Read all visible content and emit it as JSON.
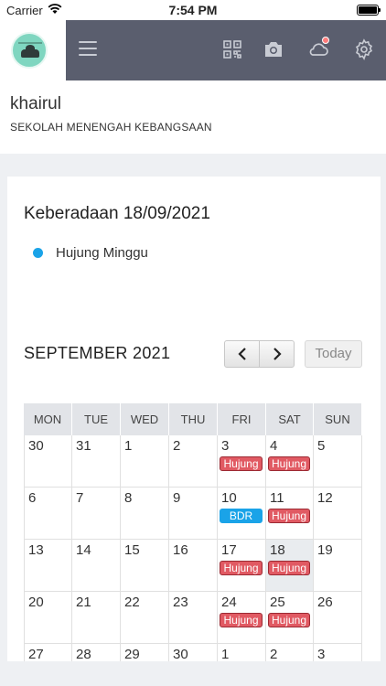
{
  "status_bar": {
    "carrier": "Carrier",
    "time": "7:54 PM"
  },
  "header": {
    "icons": [
      "menu-icon",
      "qr-code-icon",
      "camera-icon",
      "cloud-icon",
      "gear-icon"
    ],
    "colors": {
      "bar": "#5a5e6e",
      "notification": "#ff7c7c"
    }
  },
  "profile": {
    "name": "khairul",
    "school": "SEKOLAH MENENGAH KEBANGSAAN"
  },
  "attendance": {
    "title": "Keberadaan 18/09/2021",
    "legend": [
      {
        "label": "Hujung Minggu",
        "color": "#1aa3e8"
      }
    ]
  },
  "calendar": {
    "month_label": "SEPTEMBER 2021",
    "prev_label": "‹",
    "next_label": "›",
    "today_label": "Today",
    "weekdays": [
      "MON",
      "TUE",
      "WED",
      "THU",
      "FRI",
      "SAT",
      "SUN"
    ],
    "weeks": [
      [
        {
          "d": "30"
        },
        {
          "d": "31"
        },
        {
          "d": "1"
        },
        {
          "d": "2"
        },
        {
          "d": "3",
          "ev": "Hujung",
          "c": "red"
        },
        {
          "d": "4",
          "ev": "Hujung",
          "c": "red"
        },
        {
          "d": "5"
        }
      ],
      [
        {
          "d": "6"
        },
        {
          "d": "7"
        },
        {
          "d": "8"
        },
        {
          "d": "9"
        },
        {
          "d": "10",
          "ev": "BDR",
          "c": "blue"
        },
        {
          "d": "11",
          "ev": "Hujung",
          "c": "red"
        },
        {
          "d": "12"
        }
      ],
      [
        {
          "d": "13"
        },
        {
          "d": "14"
        },
        {
          "d": "15"
        },
        {
          "d": "16"
        },
        {
          "d": "17",
          "ev": "Hujung",
          "c": "red"
        },
        {
          "d": "18",
          "ev": "Hujung",
          "c": "red",
          "hl": true
        },
        {
          "d": "19"
        }
      ],
      [
        {
          "d": "20"
        },
        {
          "d": "21"
        },
        {
          "d": "22"
        },
        {
          "d": "23"
        },
        {
          "d": "24",
          "ev": "Hujung",
          "c": "red"
        },
        {
          "d": "25",
          "ev": "Hujung",
          "c": "red"
        },
        {
          "d": "26"
        }
      ],
      [
        {
          "d": "27"
        },
        {
          "d": "28"
        },
        {
          "d": "29"
        },
        {
          "d": "30"
        },
        {
          "d": "1"
        },
        {
          "d": "2"
        },
        {
          "d": "3"
        }
      ]
    ],
    "event_colors": {
      "red": "#e15a63",
      "blue": "#1aa3e8"
    }
  }
}
